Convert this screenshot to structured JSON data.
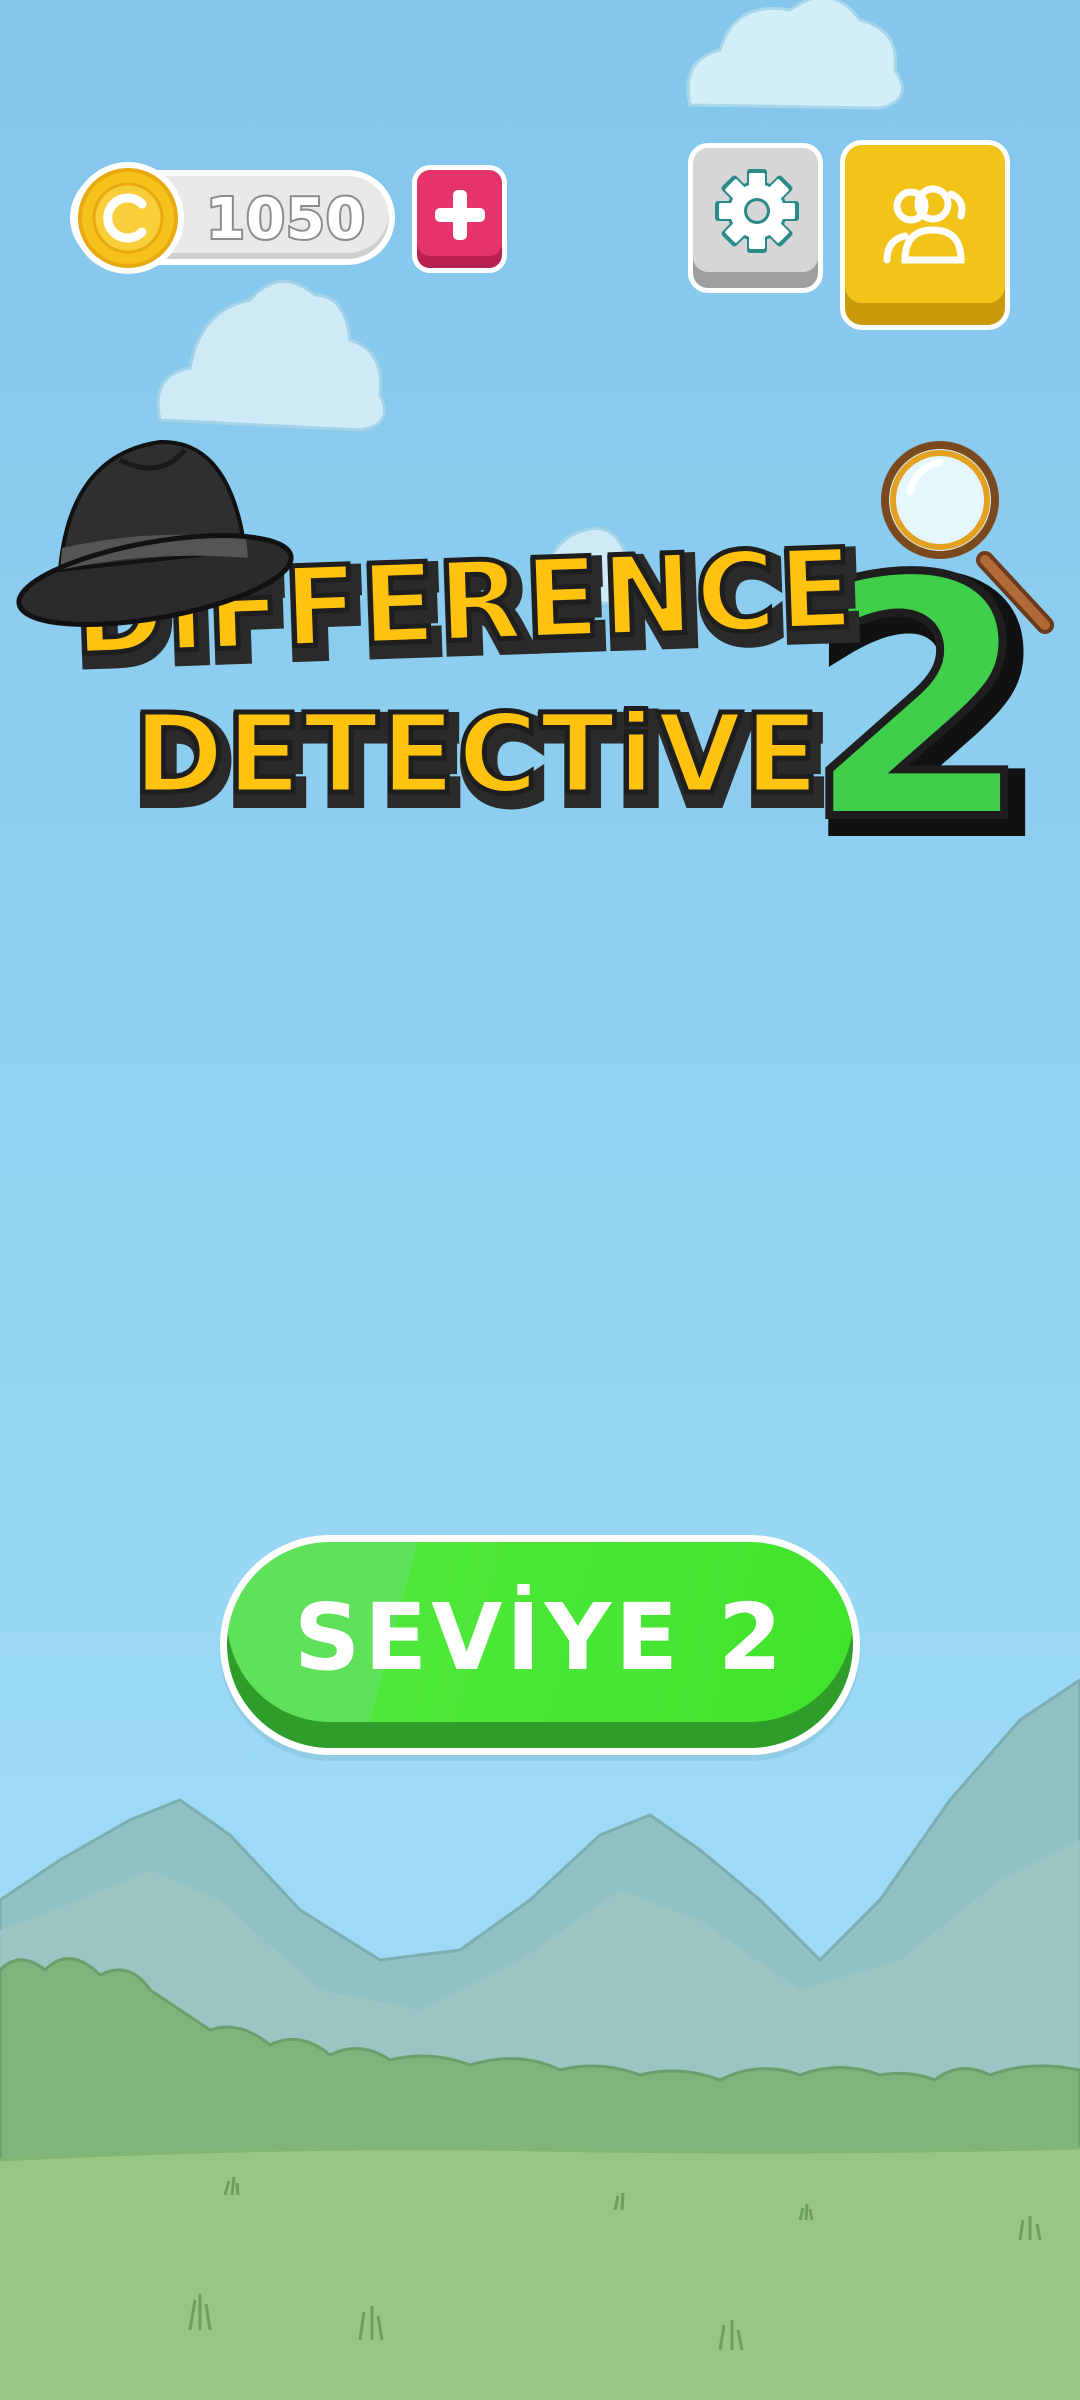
{
  "header": {
    "coin_count": "1050",
    "add_coins_icon": "plus-icon",
    "settings_icon": "gear-icon",
    "profile_icon": "users-icon"
  },
  "logo": {
    "line1": "DiFFERENCE",
    "line2": "DETECTiVE",
    "number": "2",
    "decorations": [
      "detective-hat",
      "magnifying-glass"
    ]
  },
  "level_button": {
    "label": "SEVİYE 2"
  },
  "colors": {
    "sky": "#8fd0f1",
    "coin_gold": "#f5c21b",
    "add_button": "#e5336b",
    "settings_button": "#d6d6d6",
    "profile_button": "#f2c419",
    "logo_yellow": "#ffc20e",
    "logo_green": "#3fcf4a",
    "level_button": "#4ee83a",
    "grass": "#98c784"
  }
}
